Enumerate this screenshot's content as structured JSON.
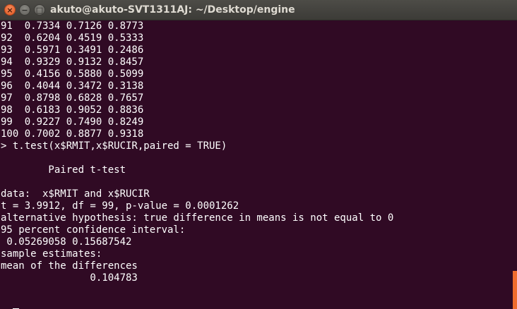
{
  "window": {
    "title": "akuto@akuto-SVT1311AJ: ~/Desktop/engine",
    "close_glyph": "×",
    "minimize_glyph": "−",
    "maximize_glyph": "□",
    "colors": {
      "background": "#300a24",
      "text": "#ffffff",
      "scroll_accent": "#ef6c2e",
      "titlebar": "#3c3b37"
    }
  },
  "terminal": {
    "lines": [
      "91  0.7334 0.7126 0.8773",
      "92  0.6204 0.4519 0.5333",
      "93  0.5971 0.3491 0.2486",
      "94  0.9329 0.9132 0.8457",
      "95  0.4156 0.5880 0.5099",
      "96  0.4044 0.3472 0.3138",
      "97  0.8798 0.6828 0.7657",
      "98  0.6183 0.9052 0.8836",
      "99  0.9227 0.7490 0.8249",
      "100 0.7002 0.8877 0.9318",
      "> t.test(x$RMIT,x$RUCIR,paired = TRUE)",
      "",
      "        Paired t-test",
      "",
      "data:  x$RMIT and x$RUCIR",
      "t = 3.9912, df = 99, p-value = 0.0001262",
      "alternative hypothesis: true difference in means is not equal to 0",
      "95 percent confidence interval:",
      " 0.05269058 0.15687542",
      "sample estimates:",
      "mean of the differences",
      "               0.104783",
      "",
      ""
    ],
    "prompt": "> "
  }
}
